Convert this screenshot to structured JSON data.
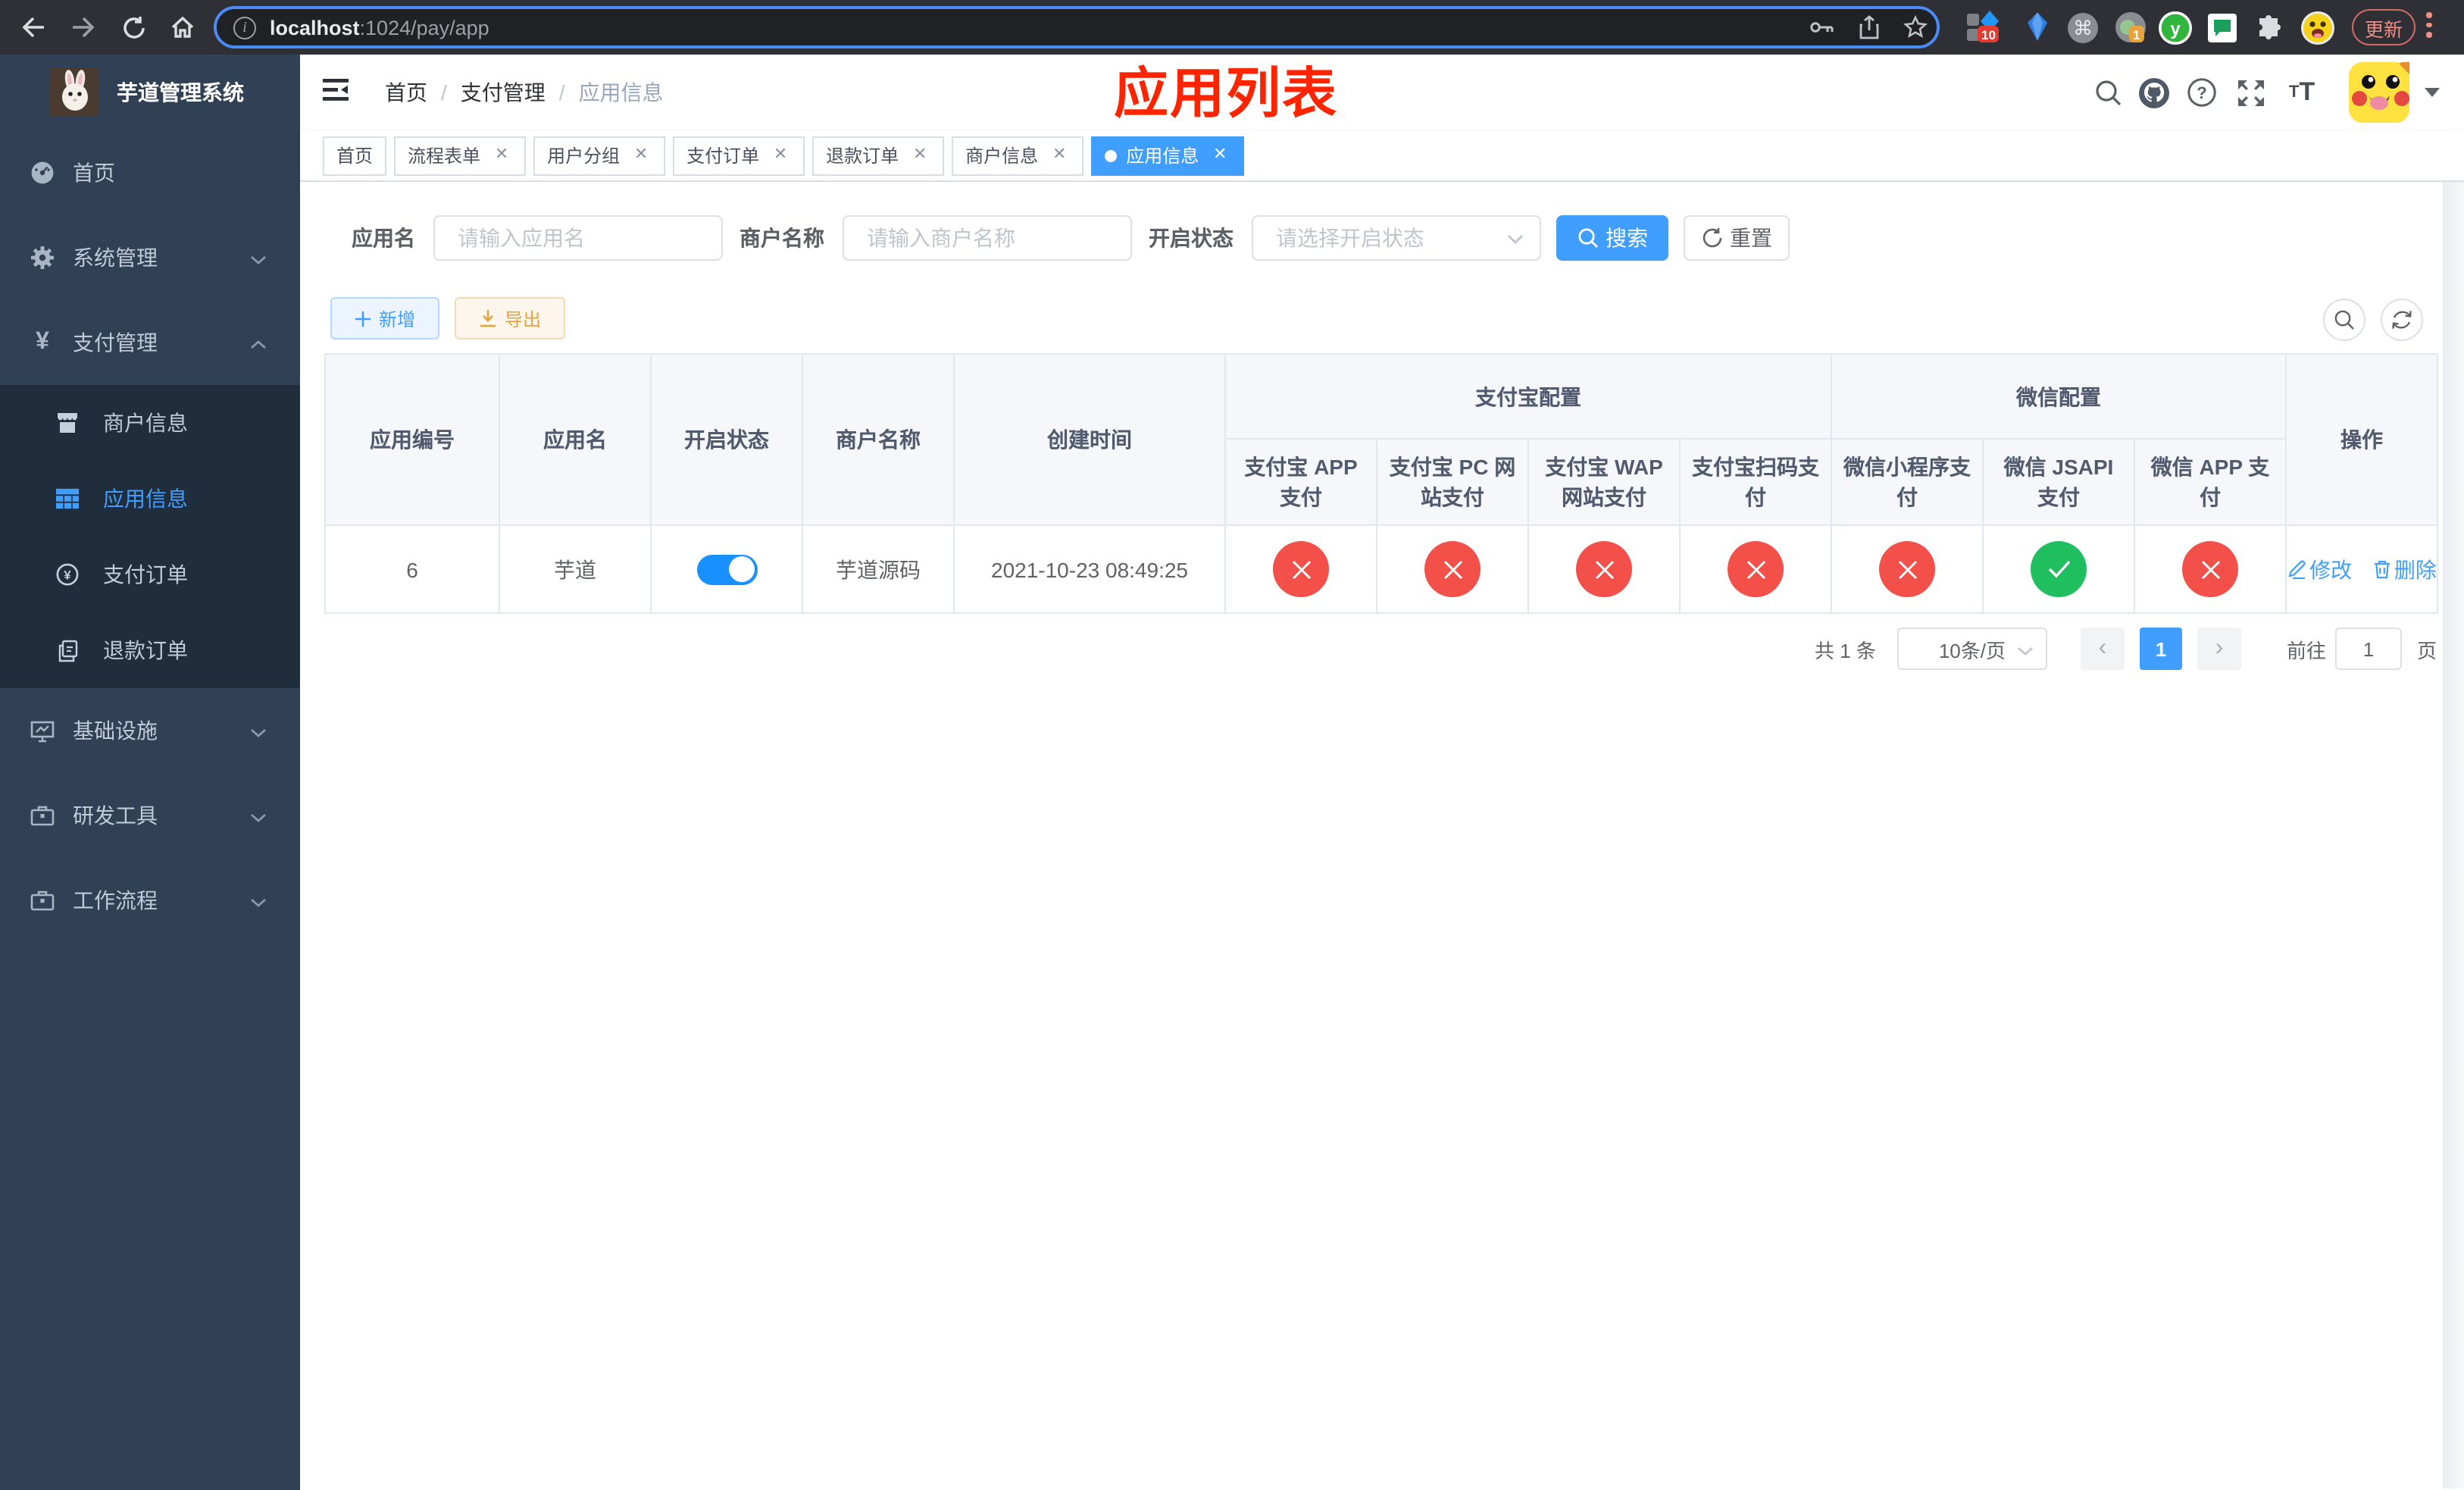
{
  "browser": {
    "url_host": "localhost",
    "url_rest": ":1024/pay/app",
    "update_label": "更新",
    "ext_badge_blue": "10",
    "ext_badge_orange": "1"
  },
  "sidebar": {
    "title": "芋道管理系统",
    "items": [
      {
        "label": "首页"
      },
      {
        "label": "系统管理"
      },
      {
        "label": "支付管理"
      },
      {
        "label": "基础设施"
      },
      {
        "label": "研发工具"
      },
      {
        "label": "工作流程"
      }
    ],
    "submenu": [
      {
        "label": "商户信息"
      },
      {
        "label": "应用信息"
      },
      {
        "label": "支付订单"
      },
      {
        "label": "退款订单"
      }
    ]
  },
  "navbar": {
    "breadcrumb": [
      "首页",
      "支付管理",
      "应用信息"
    ],
    "separator": "/"
  },
  "page_title": "应用列表",
  "tabs": [
    {
      "label": "首页",
      "closable": false,
      "active": false
    },
    {
      "label": "流程表单",
      "closable": true,
      "active": false
    },
    {
      "label": "用户分组",
      "closable": true,
      "active": false
    },
    {
      "label": "支付订单",
      "closable": true,
      "active": false
    },
    {
      "label": "退款订单",
      "closable": true,
      "active": false
    },
    {
      "label": "商户信息",
      "closable": true,
      "active": false
    },
    {
      "label": "应用信息",
      "closable": true,
      "active": true
    }
  ],
  "filters": {
    "app_name_label": "应用名",
    "app_name_placeholder": "请输入应用名",
    "merchant_label": "商户名称",
    "merchant_placeholder": "请输入商户名称",
    "status_label": "开启状态",
    "status_placeholder": "请选择开启状态",
    "search_label": "搜索",
    "reset_label": "重置"
  },
  "toolbar": {
    "add_label": "新增",
    "export_label": "导出"
  },
  "table": {
    "columns": [
      "应用编号",
      "应用名",
      "开启状态",
      "商户名称",
      "创建时间"
    ],
    "groups": [
      {
        "label": "支付宝配置",
        "children": [
          "支付宝 APP 支付",
          "支付宝 PC 网站支付",
          "支付宝 WAP 网站支付",
          "支付宝扫码支付"
        ]
      },
      {
        "label": "微信配置",
        "children": [
          "微信小程序支付",
          "微信 JSAPI 支付",
          "微信 APP 支付"
        ]
      }
    ],
    "actions_label": "操作",
    "row": {
      "id": "6",
      "name": "芋道",
      "enabled": true,
      "merchant": "芋道源码",
      "created": "2021-10-23 08:49:25",
      "channels": [
        "fail",
        "fail",
        "fail",
        "fail",
        "fail",
        "pass",
        "fail"
      ],
      "edit_label": "修改",
      "delete_label": "删除"
    }
  },
  "pagination": {
    "total": "共 1 条",
    "page_size": "10条/页",
    "current_page": "1",
    "goto_label": "前往",
    "goto_value": "1",
    "page_suffix": "页"
  }
}
